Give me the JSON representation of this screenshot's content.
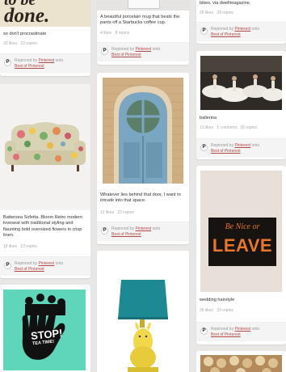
{
  "column1": {
    "card1": {
      "headline_line1": "to be",
      "headline_line2": "done.",
      "description": "so don't procrastinate",
      "stats": [
        "20 likes",
        "23 repins"
      ],
      "repinned_prefix": "Repinned by",
      "repinned_user": "Pinterest",
      "repinned_onto": "onto",
      "repinned_board": "Best of Pinterest"
    },
    "card2": {
      "description": "Battersea Sofetta. Bloom Retro modern loveseat with traditional styling and flaunting bold oversized flowers in crisp linen.",
      "stats": [
        "18 likes",
        "23 repins"
      ],
      "repinned_prefix": "Repinned by",
      "repinned_user": "Pinterest",
      "repinned_onto": "onto",
      "repinned_board": "Best of Pinterest"
    },
    "card3": {
      "poster_text_big": "STOP!",
      "poster_text_small": "TEA TIME!"
    }
  },
  "column2": {
    "card1": {
      "description": "A beautiful porcelain mug that beats the pants off a Starbucks coffee cup.",
      "stats": [
        "4 likes",
        "8 repins"
      ],
      "repinned_prefix": "Repinned by",
      "repinned_user": "Pinterest",
      "repinned_onto": "onto",
      "repinned_board": "Best of Pinterest"
    },
    "card2": {
      "description": "Whatever lies behind that door, I want to intrude into that space.",
      "stats": [
        "12 likes",
        "22 repins"
      ],
      "repinned_prefix": "Repinned by",
      "repinned_user": "Pinterest",
      "repinned_onto": "onto",
      "repinned_board": "Best of Pinterest"
    }
  },
  "column3": {
    "card1": {
      "description": "bikes, via dwellmagazine.",
      "stats": [
        "26 likes",
        "29 repins"
      ],
      "repinned_prefix": "Repinned by",
      "repinned_user": "Pinterest",
      "repinned_onto": "onto",
      "repinned_board": "Best of Pinterest"
    },
    "card2": {
      "description": "ballerina",
      "stats": [
        "13 likes",
        "1 comment",
        "26 repins"
      ],
      "repinned_prefix": "Repinned by",
      "repinned_user": "Pinterest",
      "repinned_onto": "onto",
      "repinned_board": "Best of Pinterest"
    },
    "card3": {
      "sign_line1": "Be Nice or",
      "sign_line2": "LEAVE",
      "description": "wedding hairstyle",
      "stats": [
        "36 likes",
        "33 repins"
      ],
      "repinned_prefix": "Repinned by",
      "repinned_user": "Pinterest",
      "repinned_onto": "onto",
      "repinned_board": "Best of Pinterest"
    }
  },
  "colors": {
    "background": "#e9e6e6",
    "link": "#b04a4a",
    "door_blue": "#7aa6c2",
    "lamp_teal": "#1d8a93",
    "lamp_base": "#f0d84a",
    "poster_mint": "#5fd6b9",
    "sign_orange": "#e8772a"
  }
}
